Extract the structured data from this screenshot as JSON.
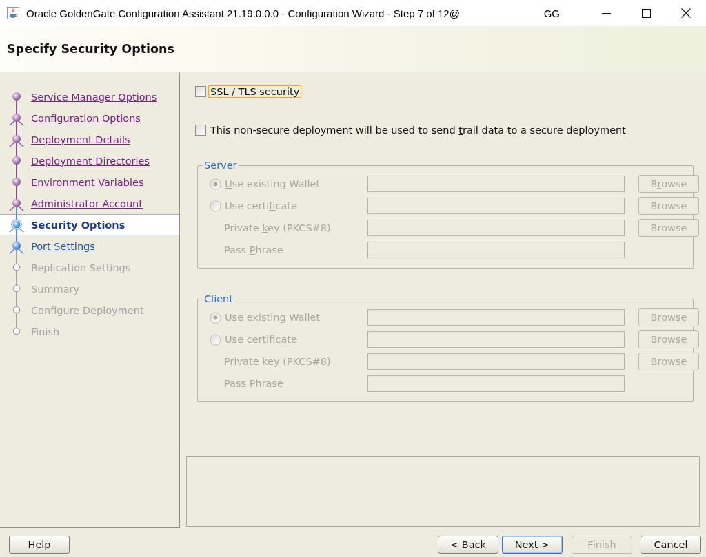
{
  "window": {
    "title": "Oracle GoldenGate Configuration Assistant 21.19.0.0.0 - Configuration Wizard - Step 7 of 12@",
    "title_tail": "GG"
  },
  "header": {
    "title": "Specify Security Options"
  },
  "steps": [
    {
      "label": "Service Manager Options",
      "kind": "plain",
      "visited": true,
      "disabled": false,
      "selected": false
    },
    {
      "label": "Configuration Options",
      "kind": "forked",
      "visited": true,
      "disabled": false,
      "selected": false
    },
    {
      "label": "Deployment Details",
      "kind": "forked",
      "visited": true,
      "disabled": false,
      "selected": false
    },
    {
      "label": "Deployment Directories",
      "kind": "plain",
      "visited": true,
      "disabled": false,
      "selected": false
    },
    {
      "label": "Environment Variables",
      "kind": "plain",
      "visited": true,
      "disabled": false,
      "selected": false
    },
    {
      "label": "Administrator Account",
      "kind": "forked",
      "visited": true,
      "disabled": false,
      "selected": false
    },
    {
      "label": "Security Options",
      "kind": "forked",
      "visited": false,
      "disabled": false,
      "selected": true
    },
    {
      "label": "Port Settings",
      "kind": "forked",
      "visited": false,
      "disabled": false,
      "selected": false
    },
    {
      "label": "Replication Settings",
      "kind": "plain",
      "visited": false,
      "disabled": true,
      "selected": false
    },
    {
      "label": "Summary",
      "kind": "plain",
      "visited": false,
      "disabled": true,
      "selected": false
    },
    {
      "label": "Configure Deployment",
      "kind": "plain",
      "visited": false,
      "disabled": true,
      "selected": false
    },
    {
      "label": "Finish",
      "kind": "plain",
      "visited": false,
      "disabled": true,
      "selected": false
    }
  ],
  "options": [
    {
      "checked": false,
      "focused": true,
      "label": [
        {
          "text": "S",
          "mnemonic": true
        },
        {
          "text": "SL / TLS security",
          "mnemonic": false
        }
      ]
    },
    {
      "checked": false,
      "focused": false,
      "label": [
        {
          "text": "This non-secure deployment will be used to send ",
          "mnemonic": false
        },
        {
          "text": "t",
          "mnemonic": true
        },
        {
          "text": "rail data to a secure deployment",
          "mnemonic": false
        }
      ]
    }
  ],
  "groups": [
    {
      "title": "Server",
      "disabled": true,
      "rows": [
        {
          "kind": "radio",
          "selected": true,
          "label": [
            {
              "text": "U",
              "mnemonic": true
            },
            {
              "text": "se existing Wallet",
              "mnemonic": false
            }
          ],
          "browse": [
            {
              "text": "B",
              "mnemonic": false
            },
            {
              "text": "r",
              "mnemonic": true
            },
            {
              "text": "owse",
              "mnemonic": false
            }
          ]
        },
        {
          "kind": "radio",
          "selected": false,
          "label": [
            {
              "text": "Use certi",
              "mnemonic": false
            },
            {
              "text": "f",
              "mnemonic": true
            },
            {
              "text": "icate",
              "mnemonic": false
            }
          ],
          "browse": [
            {
              "text": "Browse",
              "mnemonic": false
            }
          ]
        },
        {
          "kind": "field",
          "label": [
            {
              "text": "Private ",
              "mnemonic": false
            },
            {
              "text": "k",
              "mnemonic": true
            },
            {
              "text": "ey (PKCS#8)",
              "mnemonic": false
            }
          ],
          "browse": [
            {
              "text": "Browse",
              "mnemonic": false
            }
          ]
        },
        {
          "kind": "field",
          "label": [
            {
              "text": "Pass ",
              "mnemonic": false
            },
            {
              "text": "P",
              "mnemonic": true
            },
            {
              "text": "hrase",
              "mnemonic": false
            }
          ]
        }
      ]
    },
    {
      "title": "Client",
      "disabled": true,
      "rows": [
        {
          "kind": "radio",
          "selected": true,
          "label": [
            {
              "text": "Use existing ",
              "mnemonic": false
            },
            {
              "text": "W",
              "mnemonic": true
            },
            {
              "text": "allet",
              "mnemonic": false
            }
          ],
          "browse": [
            {
              "text": "Br",
              "mnemonic": false
            },
            {
              "text": "o",
              "mnemonic": true
            },
            {
              "text": "wse",
              "mnemonic": false
            }
          ]
        },
        {
          "kind": "radio",
          "selected": false,
          "label": [
            {
              "text": "Use ",
              "mnemonic": false
            },
            {
              "text": "c",
              "mnemonic": true
            },
            {
              "text": "ertificate",
              "mnemonic": false
            }
          ],
          "browse": [
            {
              "text": "Browse",
              "mnemonic": false
            }
          ]
        },
        {
          "kind": "field",
          "label": [
            {
              "text": "Private k",
              "mnemonic": false
            },
            {
              "text": "e",
              "mnemonic": true
            },
            {
              "text": "y (PKCS#8)",
              "mnemonic": false
            }
          ],
          "browse": [
            {
              "text": "Browse",
              "mnemonic": false
            }
          ]
        },
        {
          "kind": "field",
          "label": [
            {
              "text": "Pass Phr",
              "mnemonic": false
            },
            {
              "text": "a",
              "mnemonic": true
            },
            {
              "text": "se",
              "mnemonic": false
            }
          ]
        }
      ]
    }
  ],
  "buttons_left": [
    {
      "disabled": false,
      "default": false,
      "label": [
        {
          "text": "H",
          "mnemonic": true
        },
        {
          "text": "elp",
          "mnemonic": false
        }
      ]
    }
  ],
  "buttons_right": [
    {
      "disabled": false,
      "default": false,
      "label": [
        {
          "text": "< ",
          "mnemonic": false
        },
        {
          "text": "B",
          "mnemonic": true
        },
        {
          "text": "ack",
          "mnemonic": false
        }
      ]
    },
    {
      "disabled": false,
      "default": true,
      "label": [
        {
          "text": "N",
          "mnemonic": true
        },
        {
          "text": "ext >",
          "mnemonic": false
        }
      ]
    },
    {
      "disabled": true,
      "default": false,
      "label": [
        {
          "text": "F",
          "mnemonic": true
        },
        {
          "text": "inish",
          "mnemonic": false
        }
      ]
    },
    {
      "disabled": false,
      "default": false,
      "label": [
        {
          "text": "Cancel",
          "mnemonic": false
        }
      ]
    }
  ]
}
